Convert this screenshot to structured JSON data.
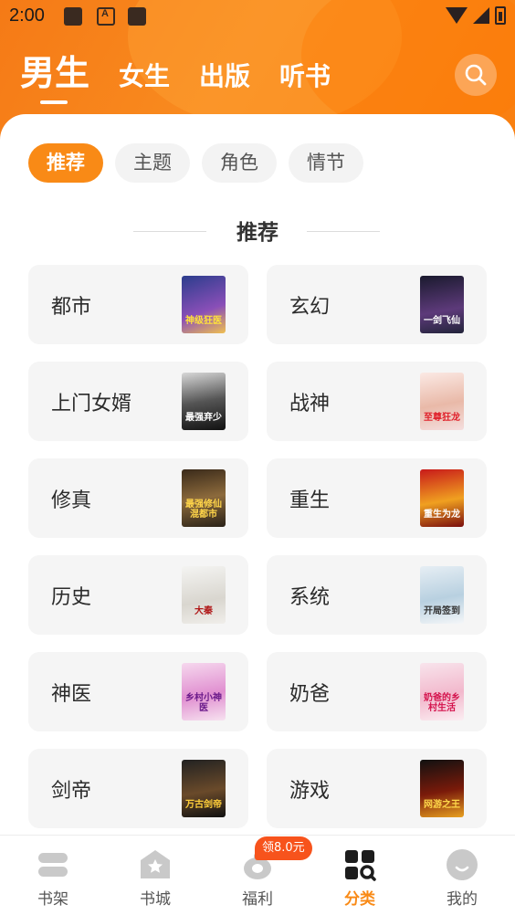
{
  "status_bar": {
    "time": "2:00",
    "notif_glyph": "A"
  },
  "header": {
    "tabs": [
      {
        "label": "男生",
        "active": true
      },
      {
        "label": "女生",
        "active": false
      },
      {
        "label": "出版",
        "active": false
      },
      {
        "label": "听书",
        "active": false
      }
    ],
    "search_icon": "search-icon"
  },
  "chips": [
    {
      "label": "推荐",
      "active": true
    },
    {
      "label": "主题",
      "active": false
    },
    {
      "label": "角色",
      "active": false
    },
    {
      "label": "情节",
      "active": false
    }
  ],
  "section": {
    "title": "推荐"
  },
  "categories": [
    {
      "label": "都市",
      "cover_text": "神级狂医"
    },
    {
      "label": "玄幻",
      "cover_text": "一剑飞仙"
    },
    {
      "label": "上门女婿",
      "cover_text": "最强弃少"
    },
    {
      "label": "战神",
      "cover_text": "至尊狂龙"
    },
    {
      "label": "修真",
      "cover_text": "最强修仙混都市"
    },
    {
      "label": "重生",
      "cover_text": "重生为龙"
    },
    {
      "label": "历史",
      "cover_text": "大秦"
    },
    {
      "label": "系统",
      "cover_text": "开局签到"
    },
    {
      "label": "神医",
      "cover_text": "乡村小神医"
    },
    {
      "label": "奶爸",
      "cover_text": "奶爸的乡村生活"
    },
    {
      "label": "剑帝",
      "cover_text": "万古剑帝"
    },
    {
      "label": "游戏",
      "cover_text": "网游之王"
    }
  ],
  "bottom_nav": {
    "items": [
      {
        "label": "书架",
        "icon": "bookshelf-icon",
        "active": false
      },
      {
        "label": "书城",
        "icon": "star-house-icon",
        "active": false
      },
      {
        "label": "福利",
        "icon": "gift-pot-icon",
        "active": false
      },
      {
        "label": "分类",
        "icon": "category-grid-icon",
        "active": true
      },
      {
        "label": "我的",
        "icon": "profile-icon",
        "active": false
      }
    ],
    "badge": "领8.0元"
  },
  "colors": {
    "accent": "#f98a16",
    "badge": "#f7531c"
  }
}
